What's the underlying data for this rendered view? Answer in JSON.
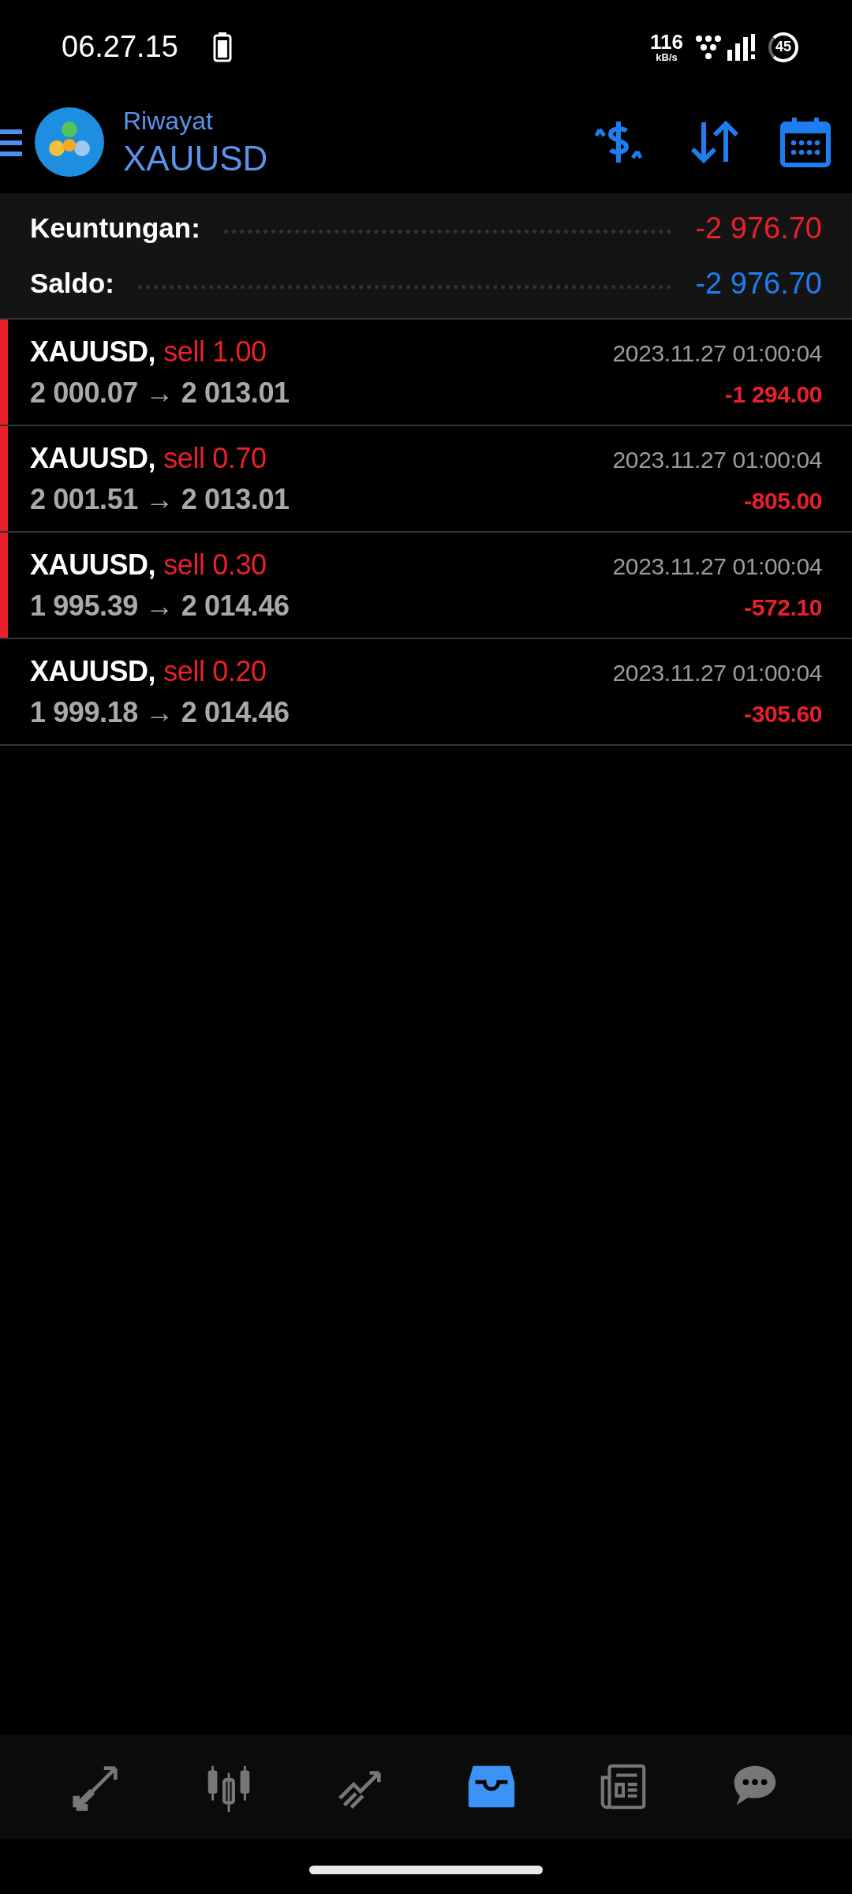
{
  "status_bar": {
    "time": "06.27.15",
    "speed": "116",
    "speed_unit": "kB/s",
    "battery_badge": "45"
  },
  "header": {
    "subtitle": "Riwayat",
    "title": "XAUUSD"
  },
  "summary": [
    {
      "label": "Keuntungan:",
      "value": "-2 976.70",
      "color": "#e8202a"
    },
    {
      "label": "Saldo:",
      "value": "-2 976.70",
      "color": "#1e7df0"
    }
  ],
  "deals": [
    {
      "symbol": "XAUUSD,",
      "side": "sell 1.00",
      "prices": "2 000.07 → 2 013.01",
      "time": "2023.11.27 01:00:04",
      "profit": "-1 294.00",
      "marked": true
    },
    {
      "symbol": "XAUUSD,",
      "side": "sell 0.70",
      "prices": "2 001.51 → 2 013.01",
      "time": "2023.11.27 01:00:04",
      "profit": "-805.00",
      "marked": true
    },
    {
      "symbol": "XAUUSD,",
      "side": "sell 0.30",
      "prices": "1 995.39 → 2 014.46",
      "time": "2023.11.27 01:00:04",
      "profit": "-572.10",
      "marked": true
    },
    {
      "symbol": "XAUUSD,",
      "side": "sell 0.20",
      "prices": "1 999.18 → 2 014.46",
      "time": "2023.11.27 01:00:04",
      "profit": "-305.60",
      "marked": false
    }
  ],
  "nav": [
    {
      "kind": "quotes",
      "selected": false
    },
    {
      "kind": "chart",
      "selected": false
    },
    {
      "kind": "trade",
      "selected": false
    },
    {
      "kind": "history",
      "selected": true
    },
    {
      "kind": "news",
      "selected": false
    },
    {
      "kind": "chat",
      "selected": false
    }
  ]
}
